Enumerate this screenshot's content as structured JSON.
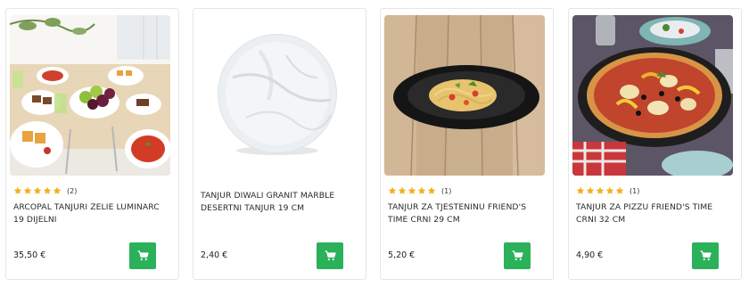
{
  "colors": {
    "accent_green": "#2ab15a",
    "star_gold": "#f2b01e",
    "card_border": "#e6e6e6"
  },
  "products": [
    {
      "title": "ARCOPAL TANJURI ZELIE LUMINARC 19 DIJELNI",
      "rating_stars": 5,
      "rating_count": "(2)",
      "price": "35,50 €",
      "image_icon": "table-setting-photo",
      "cart_icon": "cart-icon"
    },
    {
      "title": "TANJUR DIWALI GRANIT MARBLE DESERTNI TANJUR 19 cm",
      "rating_stars": 0,
      "rating_count": "",
      "price": "2,40 €",
      "image_icon": "marble-plate-photo",
      "cart_icon": "cart-icon"
    },
    {
      "title": "TANJUR ZA TJESTENINU FRIEND'S TIME CRNI 29 CM",
      "rating_stars": 5,
      "rating_count": "(1)",
      "price": "5,20 €",
      "image_icon": "pasta-plate-photo",
      "cart_icon": "cart-icon"
    },
    {
      "title": "TANJUR ZA PIZZU FRIEND'S TIME CRNI 32 CM",
      "rating_stars": 5,
      "rating_count": "(1)",
      "price": "4,90 €",
      "image_icon": "pizza-plate-photo",
      "cart_icon": "cart-icon"
    }
  ]
}
